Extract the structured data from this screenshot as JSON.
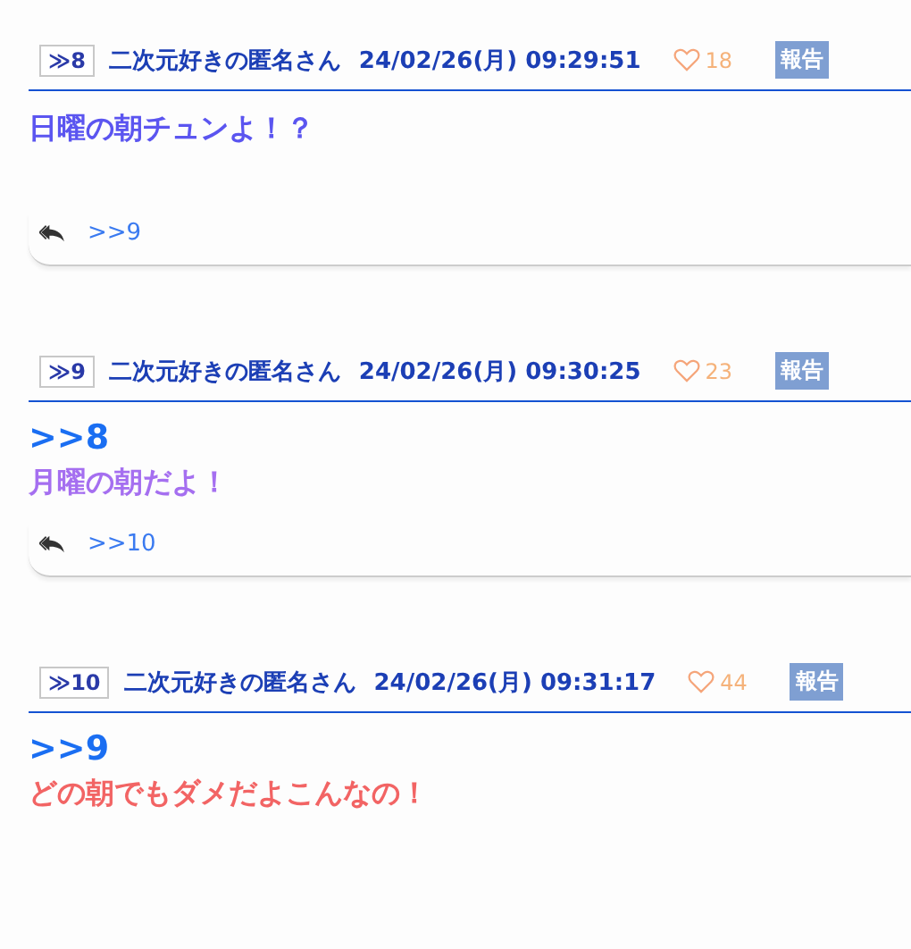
{
  "posts": [
    {
      "number": "≫8",
      "name": "二次元好きの匿名さん",
      "date": "24/02/26(月) 09:29:51",
      "likes": "18",
      "report": "報告",
      "text": "日曜の朝チュンよ！？",
      "color": "#5b55f0",
      "replies": [
        ">>9"
      ]
    },
    {
      "number": "≫9",
      "name": "二次元好きの匿名さん",
      "date": "24/02/26(月) 09:30:25",
      "likes": "23",
      "report": "報告",
      "anchors": [
        ">>8"
      ],
      "text": "月曜の朝だよ！",
      "color": "#a56ff0",
      "replies": [
        ">>10"
      ]
    },
    {
      "number": "≫10",
      "name": "二次元好きの匿名さん",
      "date": "24/02/26(月) 09:31:17",
      "likes": "44",
      "report": "報告",
      "anchors": [
        ">>9"
      ],
      "text": "どの朝でもダメだよこんなの！",
      "color": "#f26464"
    }
  ]
}
